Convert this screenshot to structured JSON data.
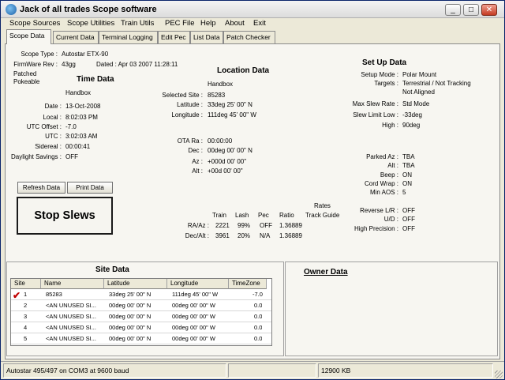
{
  "window": {
    "title": "Jack of all trades Scope software"
  },
  "menu": [
    "Scope Sources",
    "Scope Utilities",
    "Train Utils",
    "PEC File",
    "Help",
    "About",
    "Exit"
  ],
  "tabs": [
    "Scope Data",
    "Current Data",
    "Terminal Logging",
    "Edit Pec",
    "List Data",
    "Patch Checker"
  ],
  "scope": {
    "type_label": "Scope Type :",
    "type_value": "Autostar   ETX-90",
    "firmware_label": "FirmWare Rev :",
    "firmware_value": "43gg",
    "dated_label": "Dated : Apr 03 2007  11:28:11",
    "patched": "Patched",
    "pokeable": "Pokeable"
  },
  "time": {
    "heading": "Time Data",
    "source": "Handbox",
    "rows": [
      {
        "label": "Date :",
        "value": "13-Oct-2008"
      },
      {
        "label": "Local :",
        "value": "8:02:03 PM"
      },
      {
        "label": "UTC Offset :",
        "value": "-7.0"
      },
      {
        "label": "UTC :",
        "value": "3:02:03 AM"
      },
      {
        "label": "Sidereal :",
        "value": "00:00:41"
      },
      {
        "label": "Daylight Savings :",
        "value": "OFF"
      }
    ]
  },
  "buttons": {
    "refresh": "Refresh Data",
    "print": "Print Data",
    "stop": "Stop Slews"
  },
  "location": {
    "heading": "Location Data",
    "source": "Handbox",
    "rows": [
      {
        "label": "Selected Site :",
        "value": "85283"
      },
      {
        "label": "Latitude :",
        "value": "33deg 25' 00\" N"
      },
      {
        "label": "Longitude :",
        "value": "111deg 45' 00\" W"
      }
    ],
    "ota_rows": [
      {
        "label": "OTA  Ra :",
        "value": "00:00:00"
      },
      {
        "label": "Dec :",
        "value": "00deg 00' 00\" N"
      },
      {
        "label": "Az :",
        "value": "+000d 00' 00\""
      },
      {
        "label": "Alt :",
        "value": "+00d 00' 00\""
      }
    ]
  },
  "rates": {
    "heading": "Rates",
    "headers": [
      "Train",
      "Lash",
      "Pec",
      "Ratio",
      "Track Guide"
    ],
    "rows": [
      {
        "label": "RA/Az :",
        "train": "2221",
        "lash": "99%",
        "pec": "OFF",
        "ratio": "1.36889"
      },
      {
        "label": "Dec/Alt :",
        "train": "3961",
        "lash": "20%",
        "pec": "N/A",
        "ratio": "1.36889"
      }
    ]
  },
  "setup": {
    "heading": "Set Up Data",
    "rows": [
      {
        "label": "Setup Mode :",
        "value": "Polar Mount"
      },
      {
        "label": "Targets :",
        "value": "Terrestrial / Not Tracking"
      },
      {
        "label": "",
        "value": "Not Aligned"
      },
      {
        "label": "Max Slew Rate :",
        "value": "Std Mode"
      },
      {
        "label": "Slew Limit  Low :",
        "value": "-33deg"
      },
      {
        "label": "High :",
        "value": "90deg"
      },
      {
        "label": "Parked Az :",
        "value": "TBA"
      },
      {
        "label": "Alt :",
        "value": "TBA"
      },
      {
        "label": "Beep :",
        "value": "ON"
      },
      {
        "label": "Cord Wrap :",
        "value": "ON"
      },
      {
        "label": "Min AOS :",
        "value": "5"
      },
      {
        "label": "Reverse L/R :",
        "value": "OFF"
      },
      {
        "label": "U/D :",
        "value": "OFF"
      },
      {
        "label": "High Precision :",
        "value": "OFF"
      }
    ]
  },
  "sites": {
    "heading": "Site Data",
    "columns": [
      "Site",
      "Name",
      "Latitude",
      "Longitude",
      "TimeZone"
    ],
    "rows": [
      {
        "site": "1",
        "name": "85283",
        "lat": "33deg 25' 00\" N",
        "lon": "111deg 45' 00\" W",
        "tz": "-7.0"
      },
      {
        "site": "2",
        "name": "<AN UNUSED SI...",
        "lat": "00deg 00' 00\" N",
        "lon": "00deg 00' 00\" W",
        "tz": "0.0"
      },
      {
        "site": "3",
        "name": "<AN UNUSED SI...",
        "lat": "00deg 00' 00\" N",
        "lon": "00deg 00' 00\" W",
        "tz": "0.0"
      },
      {
        "site": "4",
        "name": "<AN UNUSED SI...",
        "lat": "00deg 00' 00\" N",
        "lon": "00deg 00' 00\" W",
        "tz": "0.0"
      },
      {
        "site": "5",
        "name": "<AN UNUSED SI...",
        "lat": "00deg 00' 00\" N",
        "lon": "00deg 00' 00\" W",
        "tz": "0.0"
      }
    ]
  },
  "owner": {
    "heading": "Owner Data"
  },
  "status": {
    "connection": "Autostar 495/497 on COM3 at 9600 baud",
    "memory": "12900 KB"
  }
}
